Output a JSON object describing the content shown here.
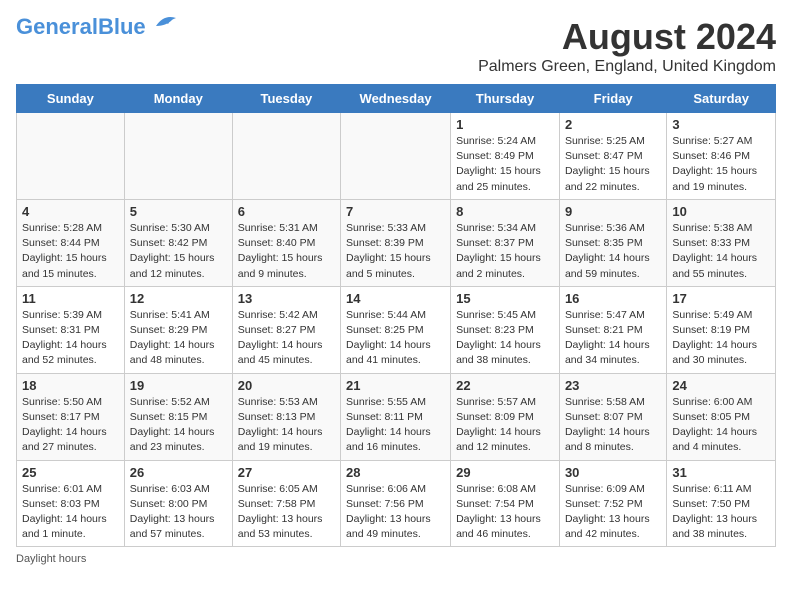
{
  "header": {
    "logo_line1": "General",
    "logo_line2": "Blue",
    "main_title": "August 2024",
    "subtitle": "Palmers Green, England, United Kingdom"
  },
  "days_of_week": [
    "Sunday",
    "Monday",
    "Tuesday",
    "Wednesday",
    "Thursday",
    "Friday",
    "Saturday"
  ],
  "weeks": [
    [
      {
        "day": "",
        "info": ""
      },
      {
        "day": "",
        "info": ""
      },
      {
        "day": "",
        "info": ""
      },
      {
        "day": "",
        "info": ""
      },
      {
        "day": "1",
        "info": "Sunrise: 5:24 AM\nSunset: 8:49 PM\nDaylight: 15 hours\nand 25 minutes."
      },
      {
        "day": "2",
        "info": "Sunrise: 5:25 AM\nSunset: 8:47 PM\nDaylight: 15 hours\nand 22 minutes."
      },
      {
        "day": "3",
        "info": "Sunrise: 5:27 AM\nSunset: 8:46 PM\nDaylight: 15 hours\nand 19 minutes."
      }
    ],
    [
      {
        "day": "4",
        "info": "Sunrise: 5:28 AM\nSunset: 8:44 PM\nDaylight: 15 hours\nand 15 minutes."
      },
      {
        "day": "5",
        "info": "Sunrise: 5:30 AM\nSunset: 8:42 PM\nDaylight: 15 hours\nand 12 minutes."
      },
      {
        "day": "6",
        "info": "Sunrise: 5:31 AM\nSunset: 8:40 PM\nDaylight: 15 hours\nand 9 minutes."
      },
      {
        "day": "7",
        "info": "Sunrise: 5:33 AM\nSunset: 8:39 PM\nDaylight: 15 hours\nand 5 minutes."
      },
      {
        "day": "8",
        "info": "Sunrise: 5:34 AM\nSunset: 8:37 PM\nDaylight: 15 hours\nand 2 minutes."
      },
      {
        "day": "9",
        "info": "Sunrise: 5:36 AM\nSunset: 8:35 PM\nDaylight: 14 hours\nand 59 minutes."
      },
      {
        "day": "10",
        "info": "Sunrise: 5:38 AM\nSunset: 8:33 PM\nDaylight: 14 hours\nand 55 minutes."
      }
    ],
    [
      {
        "day": "11",
        "info": "Sunrise: 5:39 AM\nSunset: 8:31 PM\nDaylight: 14 hours\nand 52 minutes."
      },
      {
        "day": "12",
        "info": "Sunrise: 5:41 AM\nSunset: 8:29 PM\nDaylight: 14 hours\nand 48 minutes."
      },
      {
        "day": "13",
        "info": "Sunrise: 5:42 AM\nSunset: 8:27 PM\nDaylight: 14 hours\nand 45 minutes."
      },
      {
        "day": "14",
        "info": "Sunrise: 5:44 AM\nSunset: 8:25 PM\nDaylight: 14 hours\nand 41 minutes."
      },
      {
        "day": "15",
        "info": "Sunrise: 5:45 AM\nSunset: 8:23 PM\nDaylight: 14 hours\nand 38 minutes."
      },
      {
        "day": "16",
        "info": "Sunrise: 5:47 AM\nSunset: 8:21 PM\nDaylight: 14 hours\nand 34 minutes."
      },
      {
        "day": "17",
        "info": "Sunrise: 5:49 AM\nSunset: 8:19 PM\nDaylight: 14 hours\nand 30 minutes."
      }
    ],
    [
      {
        "day": "18",
        "info": "Sunrise: 5:50 AM\nSunset: 8:17 PM\nDaylight: 14 hours\nand 27 minutes."
      },
      {
        "day": "19",
        "info": "Sunrise: 5:52 AM\nSunset: 8:15 PM\nDaylight: 14 hours\nand 23 minutes."
      },
      {
        "day": "20",
        "info": "Sunrise: 5:53 AM\nSunset: 8:13 PM\nDaylight: 14 hours\nand 19 minutes."
      },
      {
        "day": "21",
        "info": "Sunrise: 5:55 AM\nSunset: 8:11 PM\nDaylight: 14 hours\nand 16 minutes."
      },
      {
        "day": "22",
        "info": "Sunrise: 5:57 AM\nSunset: 8:09 PM\nDaylight: 14 hours\nand 12 minutes."
      },
      {
        "day": "23",
        "info": "Sunrise: 5:58 AM\nSunset: 8:07 PM\nDaylight: 14 hours\nand 8 minutes."
      },
      {
        "day": "24",
        "info": "Sunrise: 6:00 AM\nSunset: 8:05 PM\nDaylight: 14 hours\nand 4 minutes."
      }
    ],
    [
      {
        "day": "25",
        "info": "Sunrise: 6:01 AM\nSunset: 8:03 PM\nDaylight: 14 hours\nand 1 minute."
      },
      {
        "day": "26",
        "info": "Sunrise: 6:03 AM\nSunset: 8:00 PM\nDaylight: 13 hours\nand 57 minutes."
      },
      {
        "day": "27",
        "info": "Sunrise: 6:05 AM\nSunset: 7:58 PM\nDaylight: 13 hours\nand 53 minutes."
      },
      {
        "day": "28",
        "info": "Sunrise: 6:06 AM\nSunset: 7:56 PM\nDaylight: 13 hours\nand 49 minutes."
      },
      {
        "day": "29",
        "info": "Sunrise: 6:08 AM\nSunset: 7:54 PM\nDaylight: 13 hours\nand 46 minutes."
      },
      {
        "day": "30",
        "info": "Sunrise: 6:09 AM\nSunset: 7:52 PM\nDaylight: 13 hours\nand 42 minutes."
      },
      {
        "day": "31",
        "info": "Sunrise: 6:11 AM\nSunset: 7:50 PM\nDaylight: 13 hours\nand 38 minutes."
      }
    ]
  ],
  "footer": {
    "note": "Daylight hours"
  }
}
